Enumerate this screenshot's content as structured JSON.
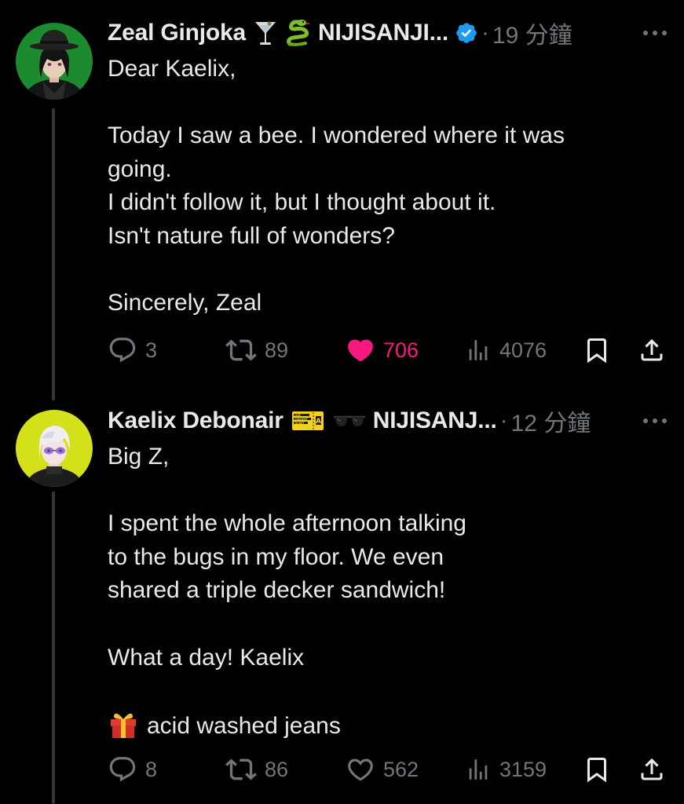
{
  "colors": {
    "background": "#000000",
    "text": "#e7e9ea",
    "secondary_text": "#71767b",
    "like_active": "#f91880",
    "verified_blue": "#1d9bf0",
    "thread_line": "#333639"
  },
  "posts": [
    {
      "author": {
        "display_name": "Zeal Ginjoka",
        "emojis": [
          "cocktail-glass-emoji",
          "snake-emoji"
        ],
        "affiliation": "NIJISANJI...",
        "verified": true,
        "avatar_color": "#1c8a2e"
      },
      "separator": "·",
      "time": "19 分鐘",
      "body_lines": [
        "Dear Kaelix,",
        "",
        "Today I saw a bee. I wondered where it was",
        "going.",
        "I didn't follow it, but I thought about it.",
        "Isn't nature full of wonders?",
        "",
        "Sincerely, Zeal"
      ],
      "actions": {
        "replies": "3",
        "reposts": "89",
        "likes": "706",
        "liked": true,
        "views": "4076"
      },
      "icons": {
        "reply": "reply-icon",
        "repost": "repost-icon",
        "like": "heart-filled-icon",
        "views": "views-icon",
        "bookmark": "bookmark-icon",
        "share": "share-icon",
        "more": "more-icon"
      }
    },
    {
      "author": {
        "display_name": "Kaelix Debonair",
        "emojis": [
          "concert-ticket-emoji",
          "sunglasses-emoji"
        ],
        "affiliation": "NIJISANJ...",
        "verified": false,
        "avatar_color": "#d4e01a"
      },
      "ticket_text": [
        "LIVE",
        "CONCERT",
        "TICKET",
        "A"
      ],
      "separator": "·",
      "time": "12 分鐘",
      "body_lines": [
        "Big Z,",
        "",
        "I spent the whole afternoon talking",
        "to the bugs in my floor. We even",
        "shared a triple decker sandwich!",
        "",
        "What a day! Kaelix",
        "",
        "acid washed jeans"
      ],
      "gift_emoji": "gift-emoji",
      "actions": {
        "replies": "8",
        "reposts": "86",
        "likes": "562",
        "liked": false,
        "views": "3159"
      },
      "icons": {
        "reply": "reply-icon",
        "repost": "repost-icon",
        "like": "heart-outline-icon",
        "views": "views-icon",
        "bookmark": "bookmark-icon",
        "share": "share-icon",
        "more": "more-icon"
      }
    }
  ]
}
